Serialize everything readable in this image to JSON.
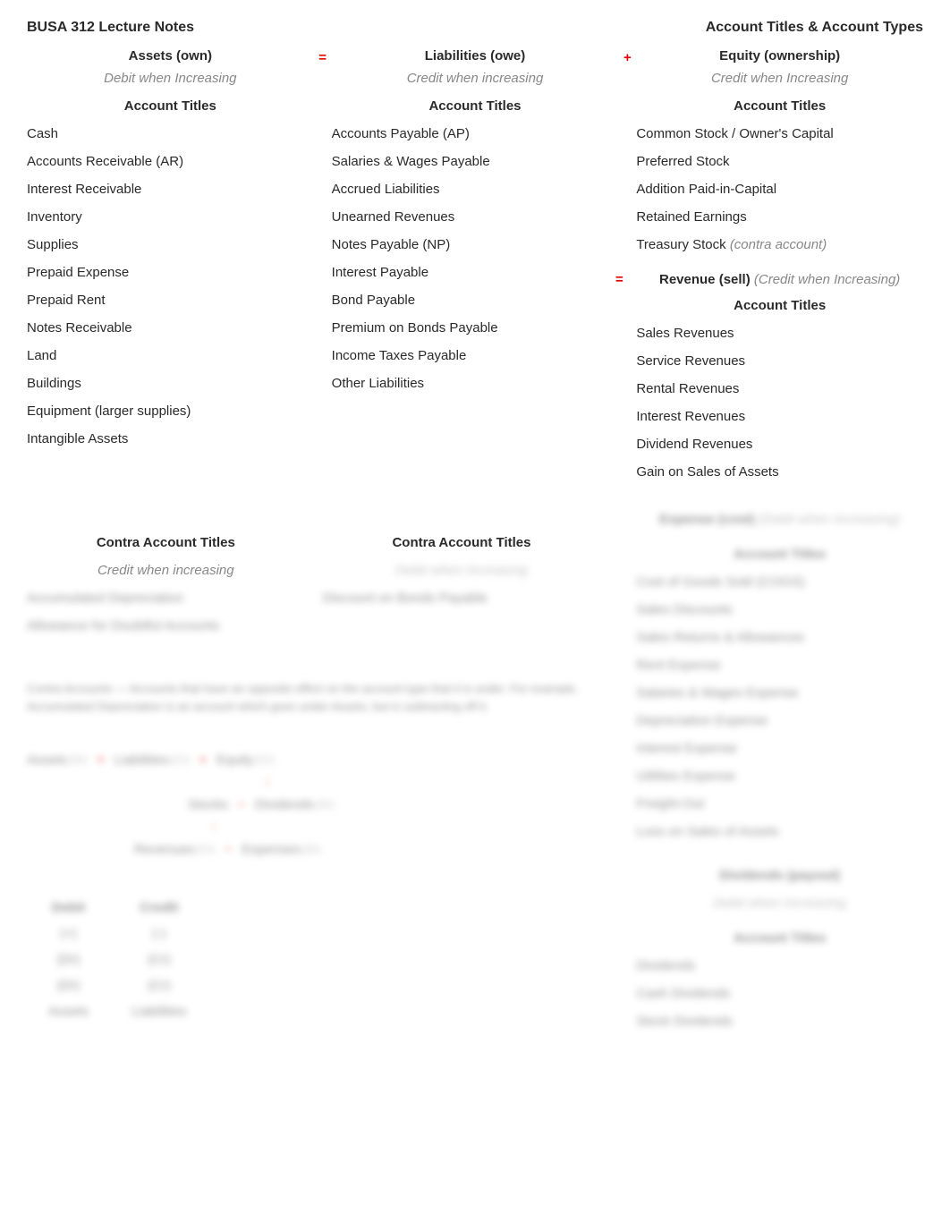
{
  "header": {
    "left": "BUSA 312 Lecture Notes",
    "right": "Account Titles & Account Types"
  },
  "columns": {
    "assets": {
      "title": "Assets (own)",
      "rule": "Debit when Increasing",
      "section": "Account Titles",
      "items": [
        "Cash",
        "Accounts Receivable (AR)",
        "Interest Receivable",
        "Inventory",
        "Supplies",
        "Prepaid Expense",
        "Prepaid Rent",
        "Notes Receivable",
        "Land",
        "Buildings",
        "Equipment (larger supplies)",
        "Intangible Assets"
      ]
    },
    "liabilities": {
      "title": "Liabilities (owe)",
      "rule": "Credit when increasing",
      "section": "Account Titles",
      "items": [
        "Accounts Payable (AP)",
        "Salaries & Wages Payable",
        "Accrued Liabilities",
        "Unearned Revenues",
        "Notes Payable (NP)",
        "Interest Payable",
        "Bond Payable",
        "Premium on Bonds Payable",
        "Income Taxes Payable",
        "Other Liabilities"
      ]
    },
    "equity": {
      "title": "Equity (ownership)",
      "rule": "Credit when Increasing",
      "section": "Account Titles",
      "items": [
        "Common Stock / Owner's Capital",
        "Preferred Stock",
        "Addition Paid-in-Capital",
        "Retained Earnings"
      ],
      "treasury_label": "Treasury Stock",
      "treasury_note": "(contra account)"
    },
    "revenue": {
      "title": "Revenue (sell)",
      "note": "(Credit when Increasing)",
      "section": "Account Titles",
      "items": [
        "Sales Revenues",
        "Service Revenues",
        "Rental Revenues",
        "Interest Revenues",
        "Dividend Revenues",
        "Gain on Sales of Assets"
      ]
    }
  },
  "operators": {
    "eq": "=",
    "plus": "+"
  },
  "contra": {
    "assets": {
      "title": "Contra Account Titles",
      "rule": "Credit when increasing",
      "items": [
        "Accumulated Depreciation",
        "Allowance for Doubtful Accounts"
      ]
    },
    "liabilities": {
      "title": "Contra Account Titles",
      "rule": "Debit when increasing",
      "items": [
        "Discount on Bonds Payable"
      ]
    }
  },
  "contra_note": "Contra Accounts — Accounts that have an opposite effect on the account type that it is under. For example, Accumulated Depreciation is an account which goes under Assets, but is subtracting off it.",
  "equation": {
    "line1": {
      "assets": "Assets",
      "assets_dc": "(Dr)",
      "liab": "Liabilities",
      "liab_dc": "(Cr)",
      "equity": "Equity",
      "equity_dc": "(Cr)"
    },
    "line2": {
      "stocks": "Stocks",
      "dividends": "Dividends",
      "dividends_dc": "(Dr)"
    },
    "line3": {
      "rev": "Revenues",
      "rev_dc": "(Cr)",
      "exp": "Expenses",
      "exp_dc": "(Dr)"
    }
  },
  "dc_table": {
    "head": {
      "debit": "Debit",
      "credit": "Credit"
    },
    "rows": [
      {
        "debit": "(+)",
        "credit": "(-)"
      },
      {
        "debit": "(Dr)",
        "credit": "(Cr)"
      },
      {
        "debit": "(Dr)",
        "credit": "(Cr)"
      },
      {
        "debit": "Assets",
        "credit": "Liabilities"
      }
    ]
  },
  "expense": {
    "title": "Expense (cost)",
    "note": "(Debit when Increasing)",
    "section": "Account Titles",
    "items": [
      "Cost of Goods Sold (COGS)",
      "Sales Discounts",
      "Sales Returns & Allowances",
      "Rent Expense",
      "Salaries & Wages Expense",
      "Depreciation Expense",
      "Interest Expense",
      "Utilities Expense",
      "Freight-Out",
      "Loss on Sales of Assets"
    ]
  },
  "dividends": {
    "title": "Dividends (payout)",
    "rule": "Debit when Increasing",
    "section": "Account Titles",
    "items": [
      "Dividends",
      "Cash Dividends",
      "Stock Dividends"
    ]
  }
}
